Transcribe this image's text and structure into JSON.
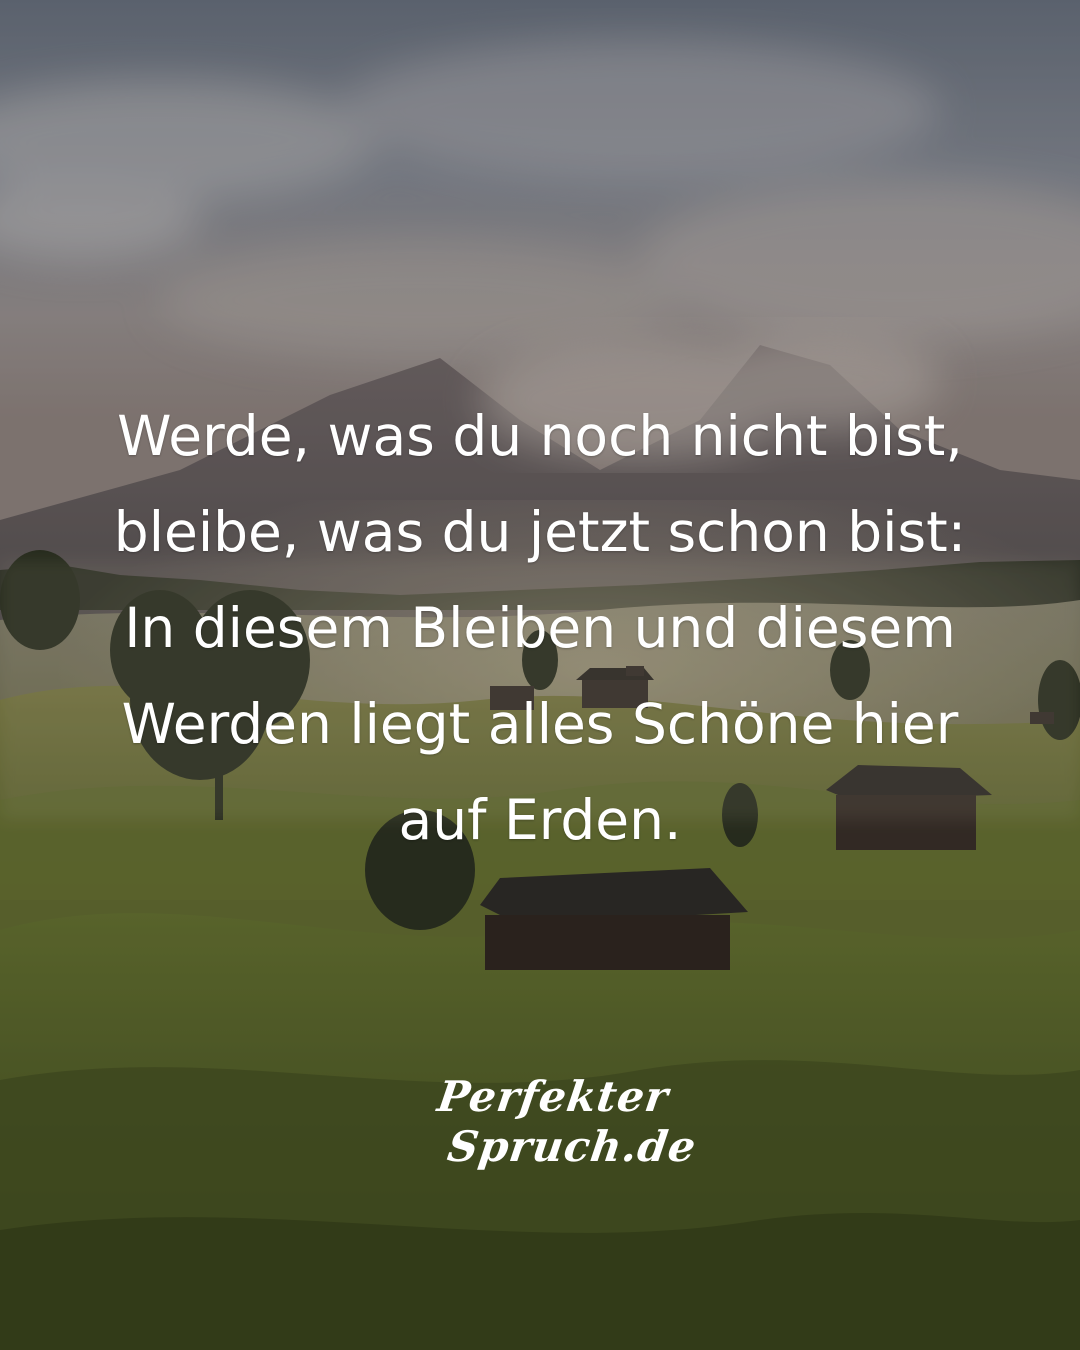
{
  "quote": {
    "lines": [
      "Werde, was du noch nicht bist,",
      "bleibe, was du jetzt schon bist:",
      "In diesem Bleiben und diesem",
      "Werden liegt alles Schöne hier",
      "auf Erden."
    ]
  },
  "brand": {
    "line1": "Perfekter",
    "line2": "Spruch.de"
  },
  "colors": {
    "text": "#ffffff",
    "sky": "#8a8f9a",
    "meadow": "#5a6a2c",
    "mountain": "#6e6868"
  }
}
